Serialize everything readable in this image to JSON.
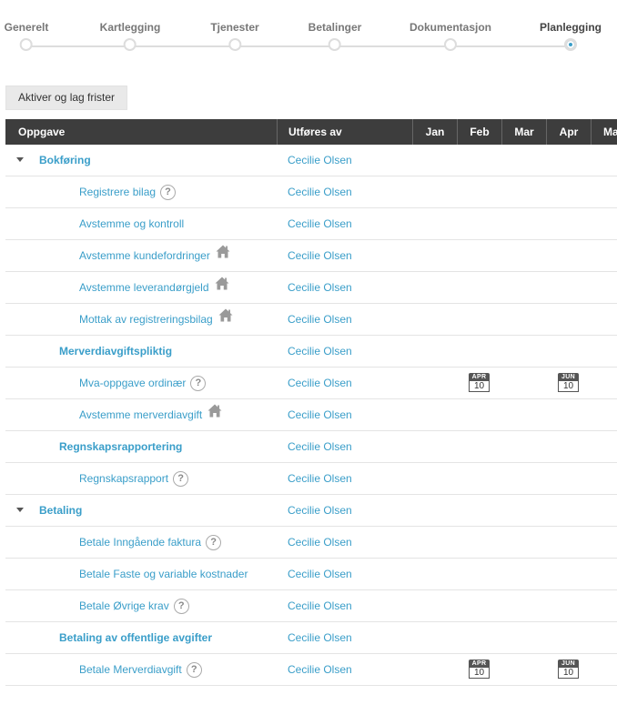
{
  "stepper": {
    "steps": [
      {
        "label": "Generelt"
      },
      {
        "label": "Kartlegging"
      },
      {
        "label": "Tjenester"
      },
      {
        "label": "Betalinger"
      },
      {
        "label": "Dokumentasjon"
      },
      {
        "label": "Planlegging"
      }
    ],
    "active_step": "Planlegging"
  },
  "toolbar": {
    "activate_label": "Aktiver og lag frister"
  },
  "table": {
    "headers": {
      "task": "Oppgave",
      "who": "Utføres av"
    },
    "months": [
      "Jan",
      "Feb",
      "Mar",
      "Apr",
      "Ma"
    ],
    "rows": [
      {
        "label": "Bokføring",
        "who": "Cecilie Olsen",
        "level": 0,
        "icon": "caret-down-icon"
      },
      {
        "label": "Registrere bilag",
        "who": "Cecilie Olsen",
        "level": 2,
        "icon": "help-icon"
      },
      {
        "label": "Avstemme og kontroll",
        "who": "Cecilie Olsen",
        "level": 2,
        "icon": ""
      },
      {
        "label": "Avstemme kundefordringer",
        "who": "Cecilie Olsen",
        "level": 2,
        "icon": "house-icon"
      },
      {
        "label": "Avstemme leverandørgjeld",
        "who": "Cecilie Olsen",
        "level": 2,
        "icon": "house-icon"
      },
      {
        "label": "Mottak av registreringsbilag",
        "who": "Cecilie Olsen",
        "level": 2,
        "icon": "house-icon"
      },
      {
        "label": "Merverdiavgiftspliktig",
        "who": "Cecilie Olsen",
        "level": 1,
        "icon": ""
      },
      {
        "label": "Mva-oppgave ordinær",
        "who": "Cecilie Olsen",
        "level": 2,
        "icon": "help-icon",
        "deadlines": [
          {
            "month": "Feb",
            "mon": "APR",
            "day": "10"
          },
          {
            "month": "Apr",
            "mon": "JUN",
            "day": "10"
          }
        ]
      },
      {
        "label": "Avstemme merverdiavgift",
        "who": "Cecilie Olsen",
        "level": 2,
        "icon": "house-icon"
      },
      {
        "label": "Regnskapsrapportering",
        "who": "Cecilie Olsen",
        "level": 1,
        "icon": ""
      },
      {
        "label": "Regnskapsrapport",
        "who": "Cecilie Olsen",
        "level": 2,
        "icon": "help-icon"
      },
      {
        "label": "Betaling",
        "who": "Cecilie Olsen",
        "level": 0,
        "icon": "caret-down-icon"
      },
      {
        "label": "Betale Inngående faktura",
        "who": "Cecilie Olsen",
        "level": 2,
        "icon": "help-icon"
      },
      {
        "label": "Betale Faste og variable kostnader",
        "who": "Cecilie Olsen",
        "level": 2,
        "icon": ""
      },
      {
        "label": "Betale Øvrige krav",
        "who": "Cecilie Olsen",
        "level": 2,
        "icon": "help-icon"
      },
      {
        "label": "Betaling av offentlige avgifter",
        "who": "Cecilie Olsen",
        "level": 1,
        "icon": ""
      },
      {
        "label": "Betale Merverdiavgift",
        "who": "Cecilie Olsen",
        "level": 2,
        "icon": "help-icon",
        "deadlines": [
          {
            "month": "Feb",
            "mon": "APR",
            "day": "10"
          },
          {
            "month": "Apr",
            "mon": "JUN",
            "day": "10"
          }
        ]
      }
    ]
  },
  "colors": {
    "accent": "#3a9ec9",
    "header_bg": "#3d3d3d"
  }
}
